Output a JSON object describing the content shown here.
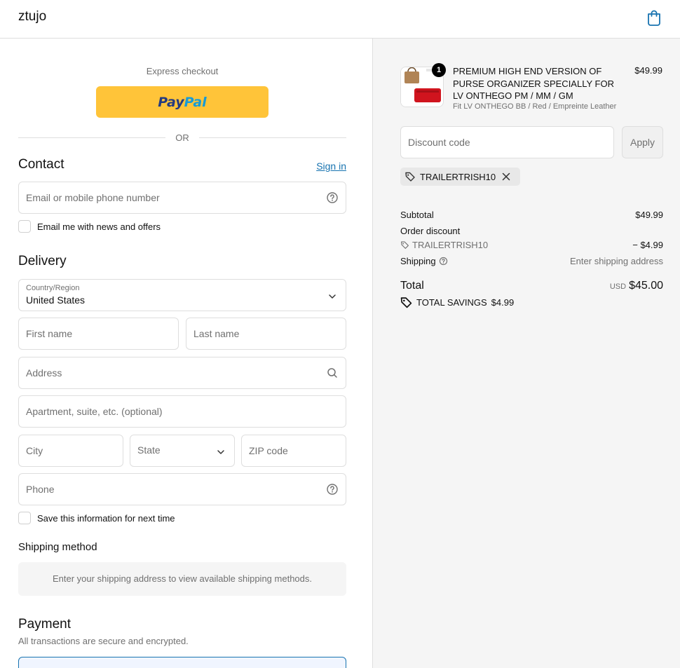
{
  "header": {
    "brand": "ztujo"
  },
  "express": {
    "label": "Express checkout",
    "paypal_part1": "Pay",
    "paypal_part2": "Pal",
    "or_text": "OR"
  },
  "contact": {
    "title": "Contact",
    "sign_in": "Sign in",
    "email_placeholder": "Email or mobile phone number",
    "news_label": "Email me with news and offers"
  },
  "delivery": {
    "title": "Delivery",
    "country_label": "Country/Region",
    "country_value": "United States",
    "first_name": "First name",
    "last_name": "Last name",
    "address": "Address",
    "apartment": "Apartment, suite, etc. (optional)",
    "city": "City",
    "state": "State",
    "zip": "ZIP code",
    "phone": "Phone",
    "save_label": "Save this information for next time"
  },
  "shipping_method": {
    "title": "Shipping method",
    "notice": "Enter your shipping address to view available shipping methods."
  },
  "payment": {
    "title": "Payment",
    "subtitle": "All transactions are secure and encrypted."
  },
  "order": {
    "product": {
      "title": "PREMIUM HIGH END VERSION OF PURSE ORGANIZER SPECIALLY FOR LV ONTHEGO PM / MM / GM",
      "variant": "Fit LV ONTHEGO BB / Red / Empreinte Leather",
      "price": "$49.99",
      "quantity": "1"
    },
    "discount_placeholder": "Discount code",
    "apply_label": "Apply",
    "applied_code": "TRAILERTRISH10",
    "subtotal_label": "Subtotal",
    "subtotal_value": "$49.99",
    "order_discount_label": "Order discount",
    "discount_code": "TRAILERTRISH10",
    "discount_value": "− $4.99",
    "shipping_label": "Shipping",
    "shipping_value": "Enter shipping address",
    "total_label": "Total",
    "total_currency": "USD",
    "total_value": "$45.00",
    "savings_label": "TOTAL SAVINGS",
    "savings_value": "$4.99"
  },
  "colors": {
    "accent": "#1773b0",
    "paypal_yellow": "#ffc439",
    "summary_bg": "#f5f5f5"
  }
}
